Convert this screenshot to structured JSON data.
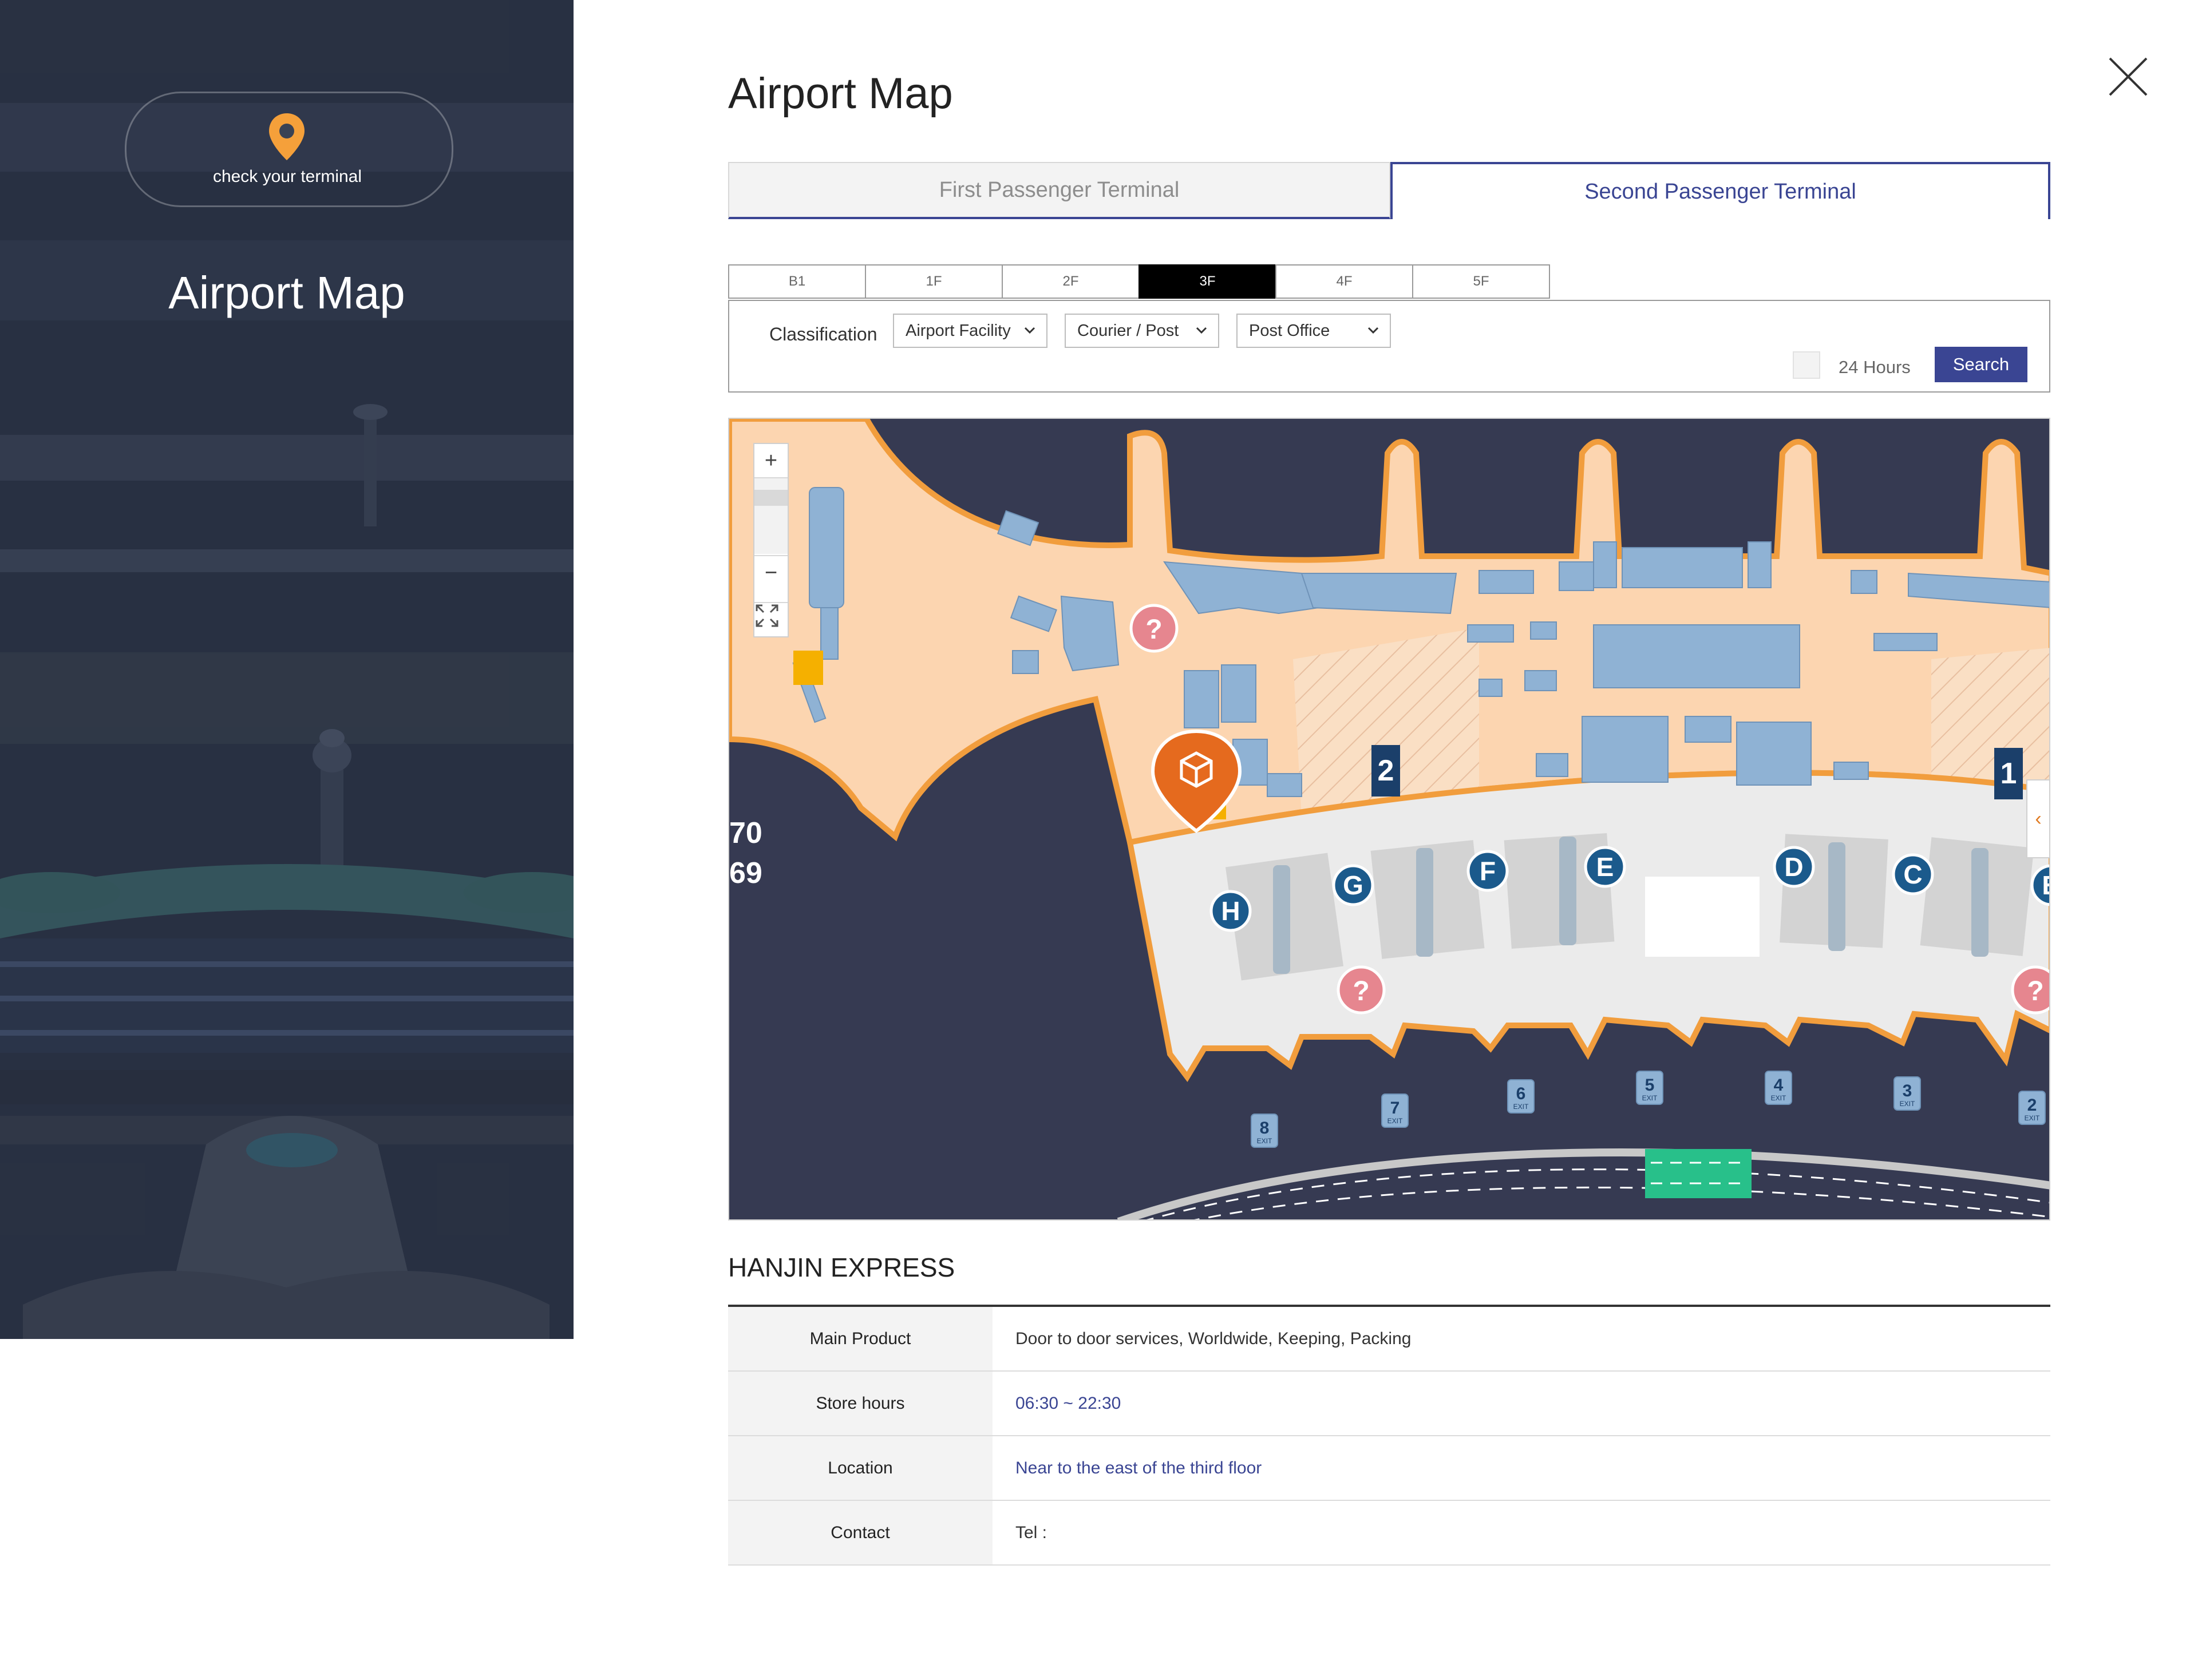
{
  "hero": {
    "terminal_check_label": "check your terminal",
    "title": "Airport Map",
    "pin_icon": "map-pin-icon",
    "accent": "#f5a03a"
  },
  "page": {
    "title": "Airport Map",
    "close_icon": "close-icon"
  },
  "tabs": [
    {
      "label": "First Passenger Terminal",
      "active": false
    },
    {
      "label": "Second Passenger Terminal",
      "active": true
    }
  ],
  "floors": [
    {
      "label": "B1",
      "active": false
    },
    {
      "label": "1F",
      "active": false
    },
    {
      "label": "2F",
      "active": false
    },
    {
      "label": "3F",
      "active": true
    },
    {
      "label": "4F",
      "active": false
    },
    {
      "label": "5F",
      "active": false
    }
  ],
  "filter": {
    "classification_label": "Classification",
    "category": "Airport Facility",
    "subcategory": "Courier / Post",
    "facility": "Post Office",
    "hours_label": "24 Hours",
    "search_label": "Search"
  },
  "map": {
    "zoom_in": "+",
    "zoom_out": "−",
    "side_toggle": "‹",
    "gate_numbers": [
      "70",
      "69"
    ],
    "counter_labels": [
      "H",
      "G",
      "F",
      "E",
      "D",
      "C",
      "B"
    ],
    "exit_labels": [
      "8",
      "7",
      "6",
      "5",
      "4",
      "3",
      "2"
    ],
    "exit_text": "EXIT",
    "stair_labels": [
      "2",
      "1"
    ],
    "colors": {
      "apron": "#363a52",
      "airside": "#fcd5b0",
      "airside_border": "#f19d3d",
      "landside": "#ebebeb",
      "shops": "#8fb2d4",
      "counter_badge": "#1b5a8c",
      "marker": "#e56a1e",
      "info_marker": "#e6868f",
      "crosswalk": "#28c08a"
    }
  },
  "detail": {
    "name": "HANJIN EXPRESS",
    "rows": [
      {
        "key": "Main Product",
        "value": "Door to door services, Worldwide, Keeping, Packing"
      },
      {
        "key": "Store hours",
        "value": "06:30 ~ 22:30"
      },
      {
        "key": "Location",
        "value": "Near to the east of the third floor"
      },
      {
        "key": "Contact",
        "value": "Tel :"
      }
    ]
  }
}
